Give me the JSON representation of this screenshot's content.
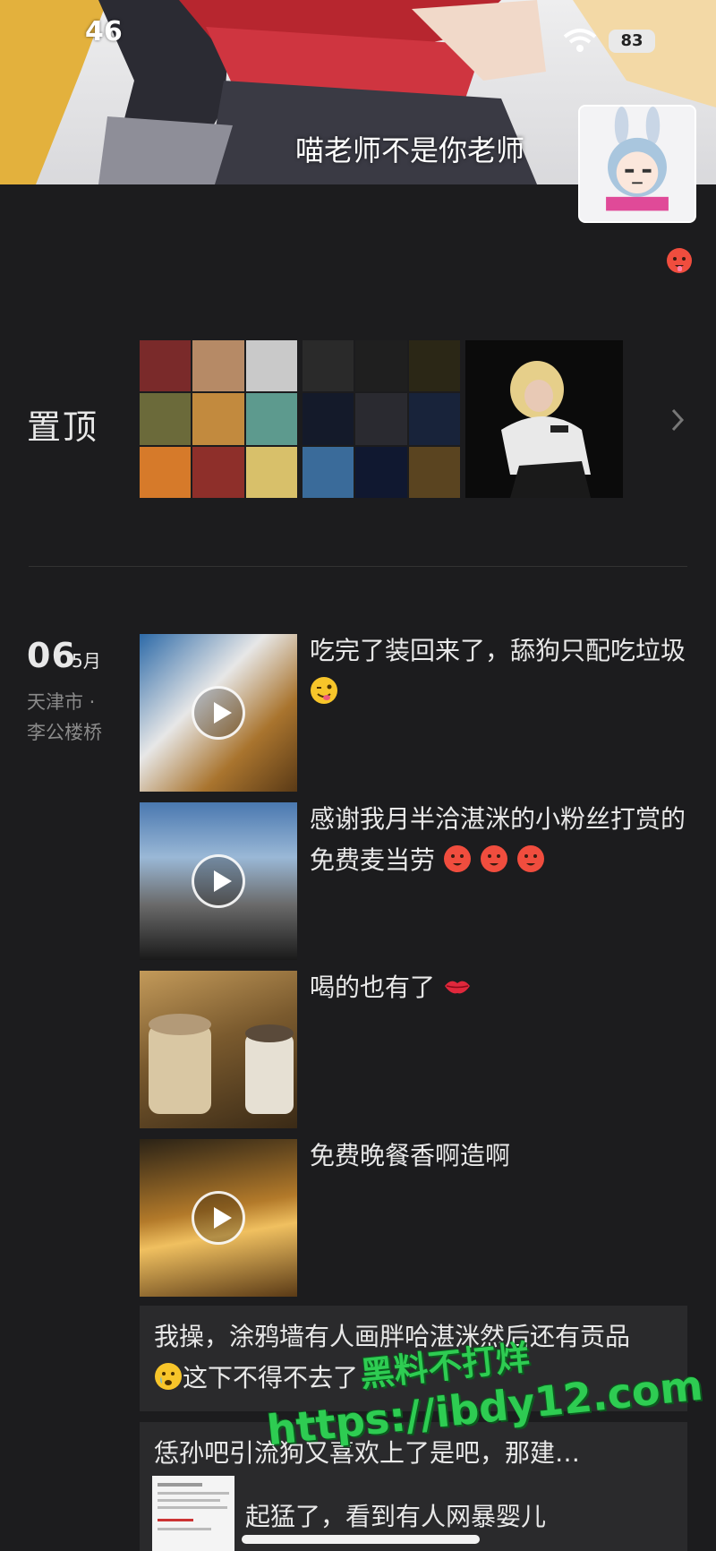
{
  "status_bar": {
    "time": "46",
    "battery": "83"
  },
  "profile": {
    "name": "喵老师不是你老师",
    "mood_icon": "hot-face-emoji"
  },
  "pinned": {
    "label": "置顶"
  },
  "date": {
    "day": "06",
    "month": "5月",
    "location_line1": "天津市 ·",
    "location_line2": "李公楼桥"
  },
  "posts": [
    {
      "text": "吃完了装回来了，舔狗只配吃垃圾",
      "emoji": "winking-face-tongue-emoji",
      "media": "video"
    },
    {
      "text": "感谢我月半洽湛洣的小粉丝打赏的免费麦当劳",
      "emoji": "hot-face-emoji",
      "media": "video"
    },
    {
      "text": "喝的也有了",
      "emoji": "lips-emoji",
      "media": "image"
    },
    {
      "text": "免费晚餐香啊造啊",
      "media": "video"
    }
  ],
  "text_posts": [
    {
      "line1": "我操，涂鸦墙有人画胖哈湛洣然后还有贡品",
      "line2": "这下不得不去了",
      "emoji": "crying-face-emoji"
    },
    {
      "line1": "恁孙吧引流狗又喜欢上了是吧，那建…"
    }
  ],
  "shared_post": {
    "text": "起猛了，看到有人网暴婴儿"
  },
  "watermark": {
    "line1": "黑料不打烊",
    "line2": "https://ibdy12.com"
  }
}
